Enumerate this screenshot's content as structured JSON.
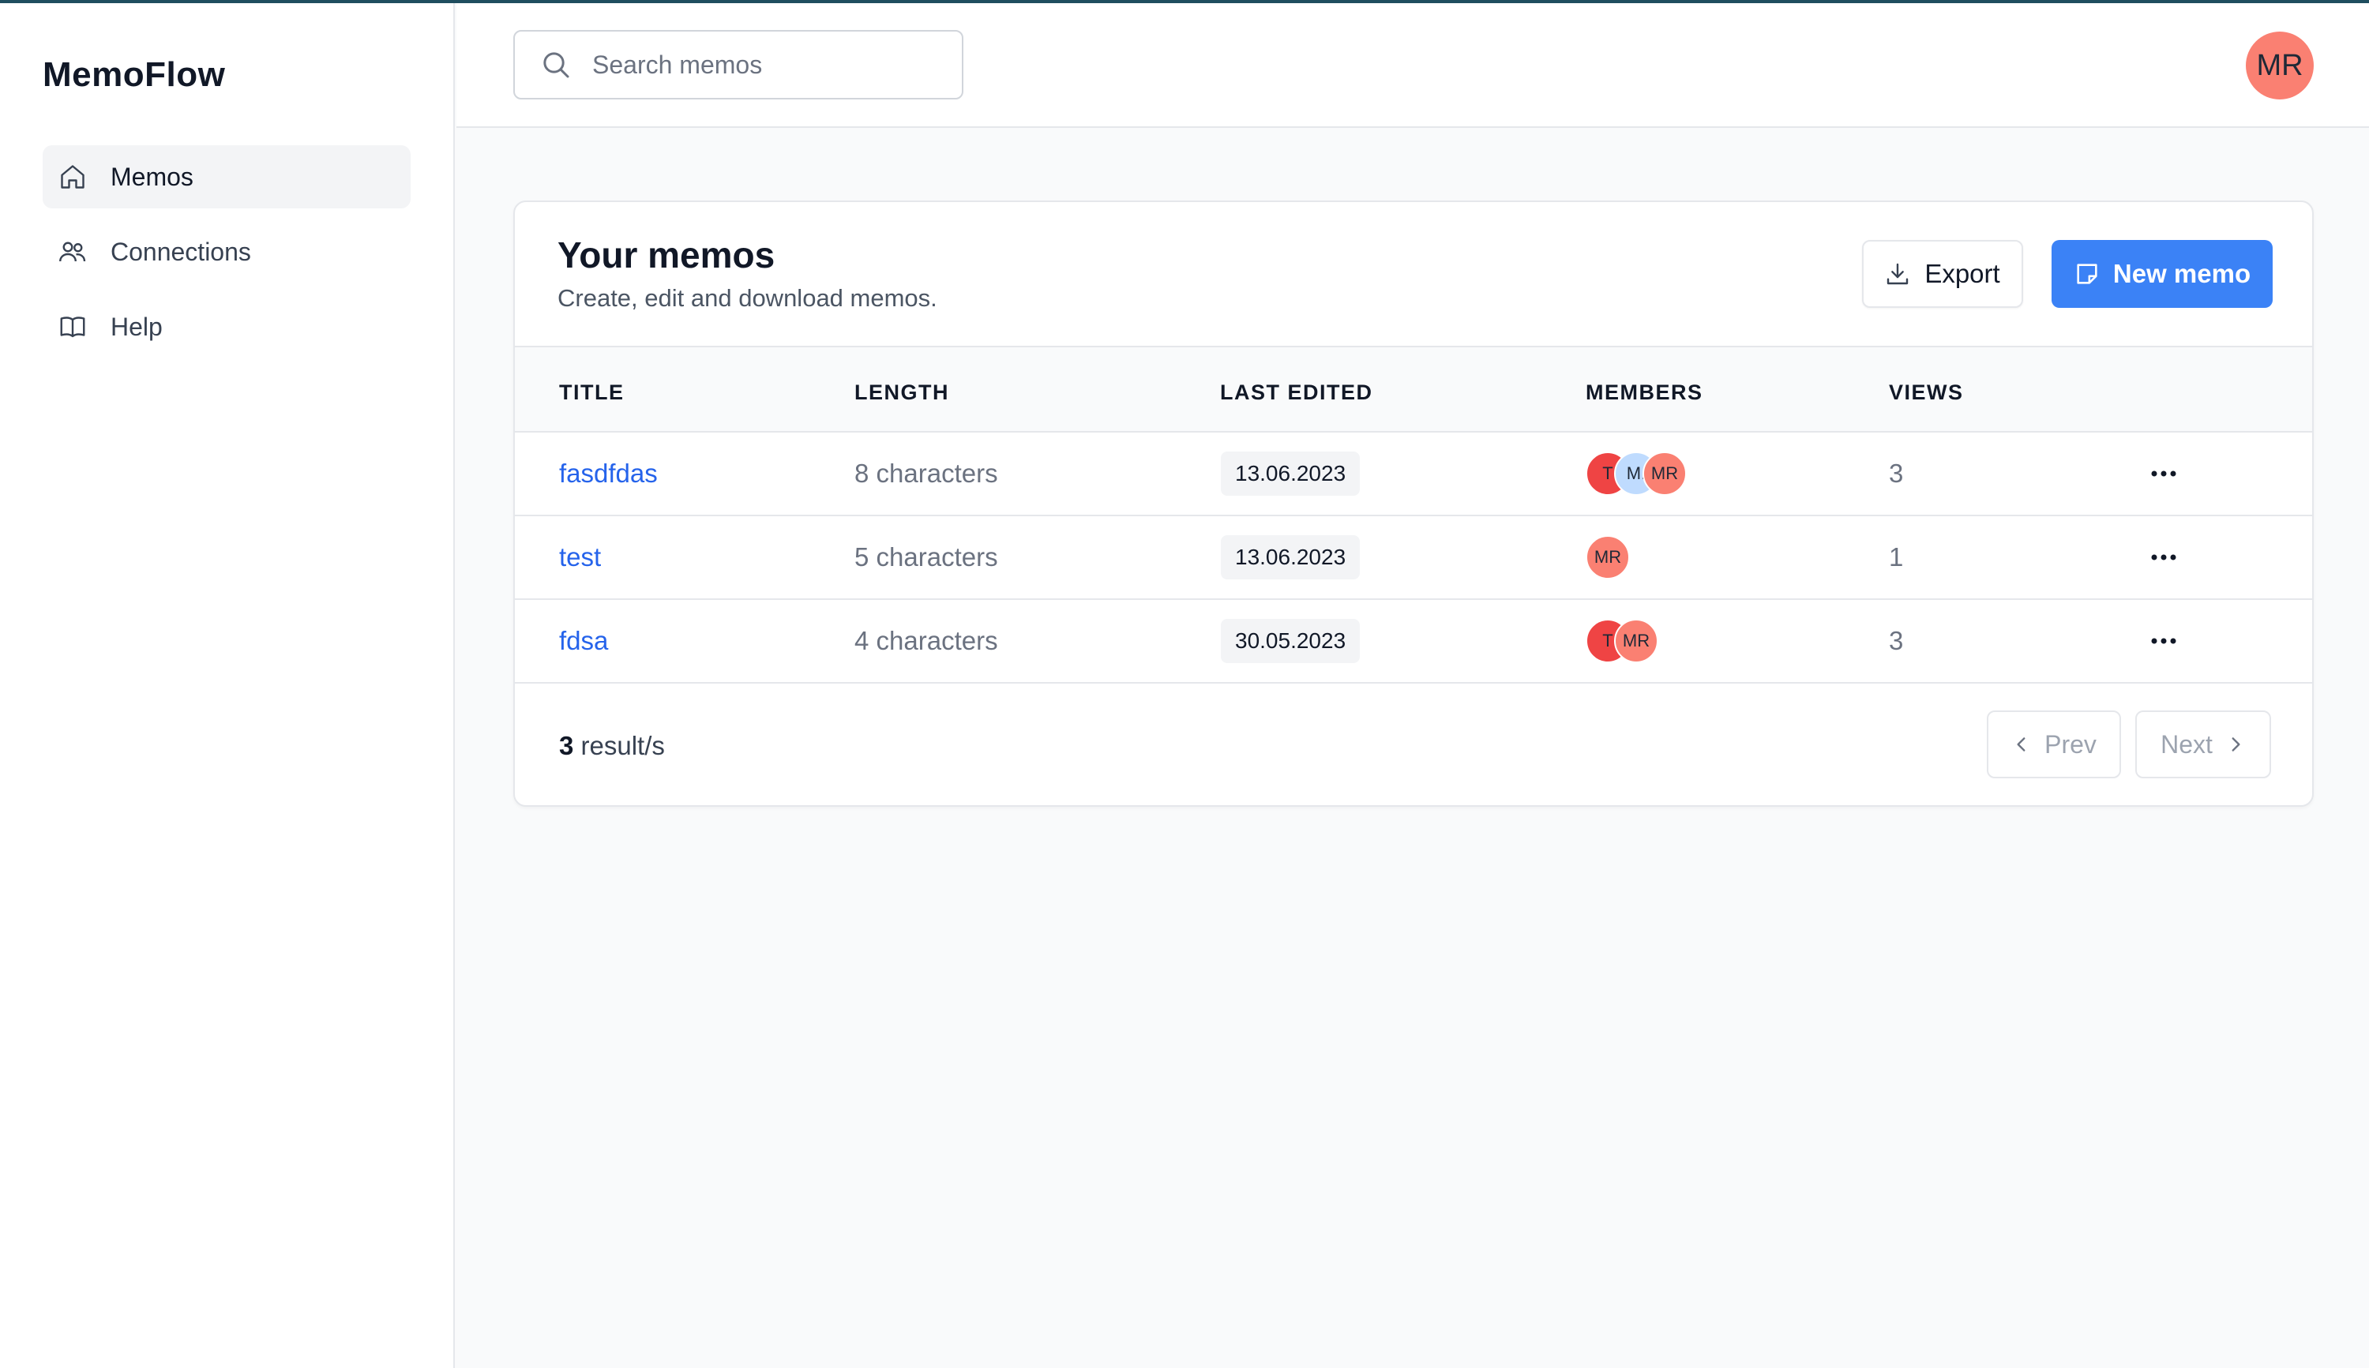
{
  "app": {
    "brand": "MemoFlow"
  },
  "sidebar": {
    "items": [
      {
        "label": "Memos",
        "icon": "home-icon",
        "active": true
      },
      {
        "label": "Connections",
        "icon": "users-icon",
        "active": false
      },
      {
        "label": "Help",
        "icon": "book-icon",
        "active": false
      }
    ]
  },
  "header": {
    "search": {
      "placeholder": "Search memos",
      "value": "",
      "icon": "search-icon"
    },
    "user": {
      "initials": "MR",
      "color": "#fa8072"
    }
  },
  "card": {
    "title": "Your memos",
    "subtitle": "Create, edit and download memos.",
    "export_label": "Export",
    "new_label": "New memo",
    "accent_color": "#3b82f6"
  },
  "table": {
    "columns": [
      "TITLE",
      "LENGTH",
      "LAST EDITED",
      "MEMBERS",
      "VIEWS"
    ],
    "rows": [
      {
        "title": "fasdfdas",
        "length": "8 characters",
        "last_edited": "13.06.2023",
        "members": [
          {
            "initials": "T",
            "color": "#ef4444"
          },
          {
            "initials": "M.",
            "color": "#bfdbfe"
          },
          {
            "initials": "MR",
            "color": "#fa8072"
          }
        ],
        "views": "3"
      },
      {
        "title": "test",
        "length": "5 characters",
        "last_edited": "13.06.2023",
        "members": [
          {
            "initials": "MR",
            "color": "#fa8072"
          }
        ],
        "views": "1"
      },
      {
        "title": "fdsa",
        "length": "4 characters",
        "last_edited": "30.05.2023",
        "members": [
          {
            "initials": "T",
            "color": "#ef4444"
          },
          {
            "initials": "MR",
            "color": "#fa8072"
          }
        ],
        "views": "3"
      }
    ]
  },
  "pagination": {
    "count": "3",
    "count_suffix": " result/s",
    "prev_label": "Prev",
    "next_label": "Next"
  }
}
